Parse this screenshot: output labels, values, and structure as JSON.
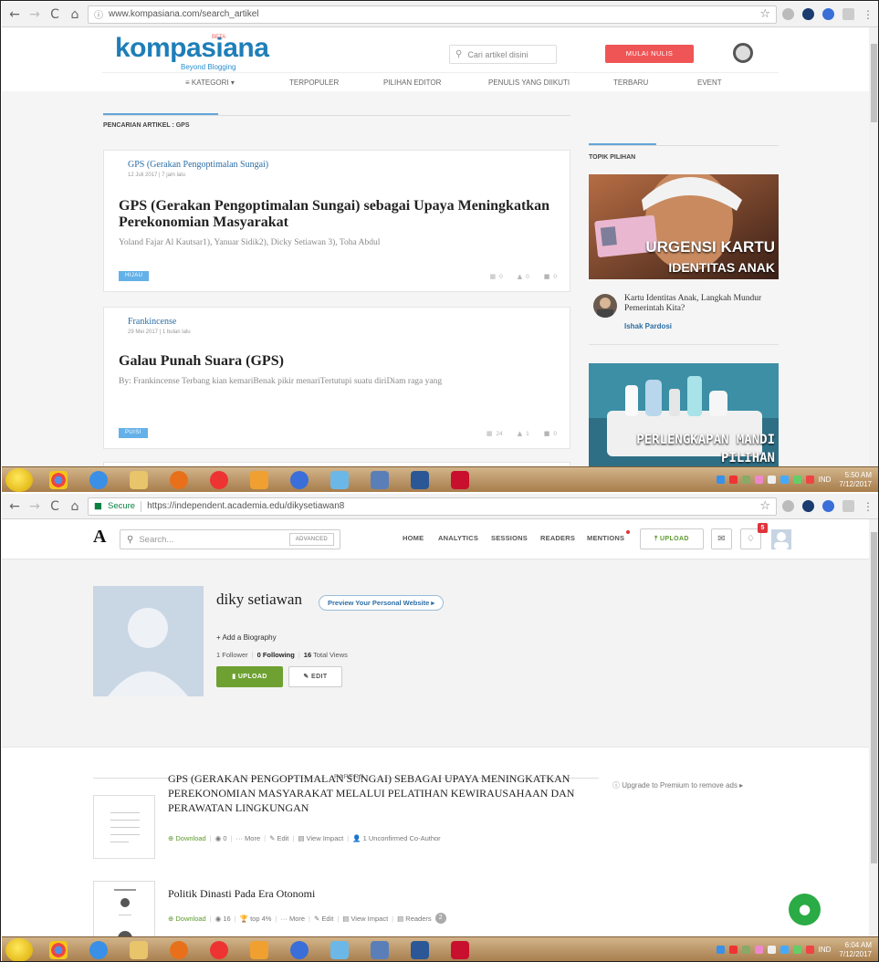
{
  "screenshot1": {
    "browser": {
      "url": "www.kompasiana.com/search_artikel"
    },
    "header": {
      "logo": "kompasiana",
      "beta": "BETA",
      "tagline": "Beyond Blogging",
      "search_placeholder": "Cari artikel disini",
      "write_button": "MULAI NULIS",
      "nav": [
        "≡ KATEGORI ▾",
        "TERPOPULER",
        "PILIHAN EDITOR",
        "PENULIS YANG DIIKUTI",
        "TERBARU",
        "EVENT"
      ]
    },
    "breadcrumb": "PENCARIAN ARTIKEL : GPS",
    "results": [
      {
        "category": "GPS (Gerakan Pengoptimalan Sungai)",
        "date": "12 Juli 2017 | 7 jam lalu",
        "title": "GPS (Gerakan Pengoptimalan Sungai) sebagai Upaya Meningkatkan Perekonomian Masyarakat",
        "excerpt": "Yoland Fajar Al Kautsar1), Yanuar Sidik2), Dicky Setiawan 3), Toha Abdul",
        "tag": "HIJAU",
        "views": "0",
        "likes": "0",
        "comments": "0"
      },
      {
        "category": "Frankincense",
        "date": "29 Mei 2017 | 1 bulan lalu",
        "title": "Galau Punah Suara (GPS)",
        "excerpt": "By: Frankincense Terbang kian kemariBenak pikir menariTertutupi suatu diriDiam raga yang",
        "tag": "PUISI",
        "views": "24",
        "likes": "1",
        "comments": "0"
      }
    ],
    "sidebar": {
      "title": "TOPIK PILIHAN",
      "banner1_line1": "URGENSI KARTU",
      "banner1_line2": "IDENTITAS ANAK",
      "article_title": "Kartu Identitas Anak, Langkah Mundur Pemerintah Kita?",
      "article_author": "Ishak Pardosi",
      "banner2_line1": "PERLENGKAPAN MANDI",
      "banner2_line2": "PILIHAN"
    },
    "taskbar": {
      "lang": "IND",
      "time": "5:50 AM",
      "date": "7/12/2017"
    }
  },
  "screenshot2": {
    "browser": {
      "secure": "Secure",
      "url": "https://independent.academia.edu/dikysetiawan8"
    },
    "header": {
      "logo": "A",
      "search_placeholder": "Search...",
      "advanced": "ADVANCED",
      "nav": [
        "HOME",
        "ANALYTICS",
        "SESSIONS",
        "READERS",
        "MENTIONS"
      ],
      "upload": "UPLOAD",
      "notification_count": "5"
    },
    "profile": {
      "name": "diky setiawan",
      "preview": "Preview Your Personal Website ▸",
      "add_bio": "Add a Biography",
      "followers": "1",
      "followers_label": "Follower",
      "following": "0",
      "following_label": "Following",
      "views": "16",
      "views_label": "Total Views",
      "upload": "UPLOAD",
      "edit": "EDIT"
    },
    "papers_label": "PAPERS",
    "premium": "Upgrade to Premium to remove ads ▸",
    "papers": [
      {
        "title": "GPS (GERAKAN PENGOPTIMALAN SUNGAI) SEBAGAI UPAYA MENINGKATKAN PEREKONOMIAN MASYARAKAT MELALUI PELATIHAN KEWIRAUSAHAAN DAN PERAWATAN LINGKUNGAN",
        "download": "Download",
        "views": "0",
        "more": "More",
        "edit": "Edit",
        "impact": "View Impact",
        "coauthor": "1 Unconfirmed Co-Author"
      },
      {
        "title": "Politik Dinasti Pada Era Otonomi",
        "download": "Download",
        "views": "16",
        "top": "top 4%",
        "more": "More",
        "edit": "Edit",
        "impact": "View Impact",
        "readers": "Readers",
        "readers_count": "2"
      }
    ],
    "taskbar": {
      "lang": "IND",
      "time": "6:04 AM",
      "date": "7/12/2017"
    }
  },
  "icons": {
    "back": "arrow-left-icon",
    "forward": "arrow-right-icon",
    "reload": "reload-icon",
    "home": "home-icon",
    "star": "star-icon",
    "search": "search-icon",
    "mail": "mail-icon",
    "bell": "bell-icon",
    "chat": "chat-icon"
  },
  "colors": {
    "kompasiana_blue": "#1e7eb8",
    "write_red": "#f05555",
    "academia_green": "#6ea131",
    "mention_red": "#e0333a"
  }
}
